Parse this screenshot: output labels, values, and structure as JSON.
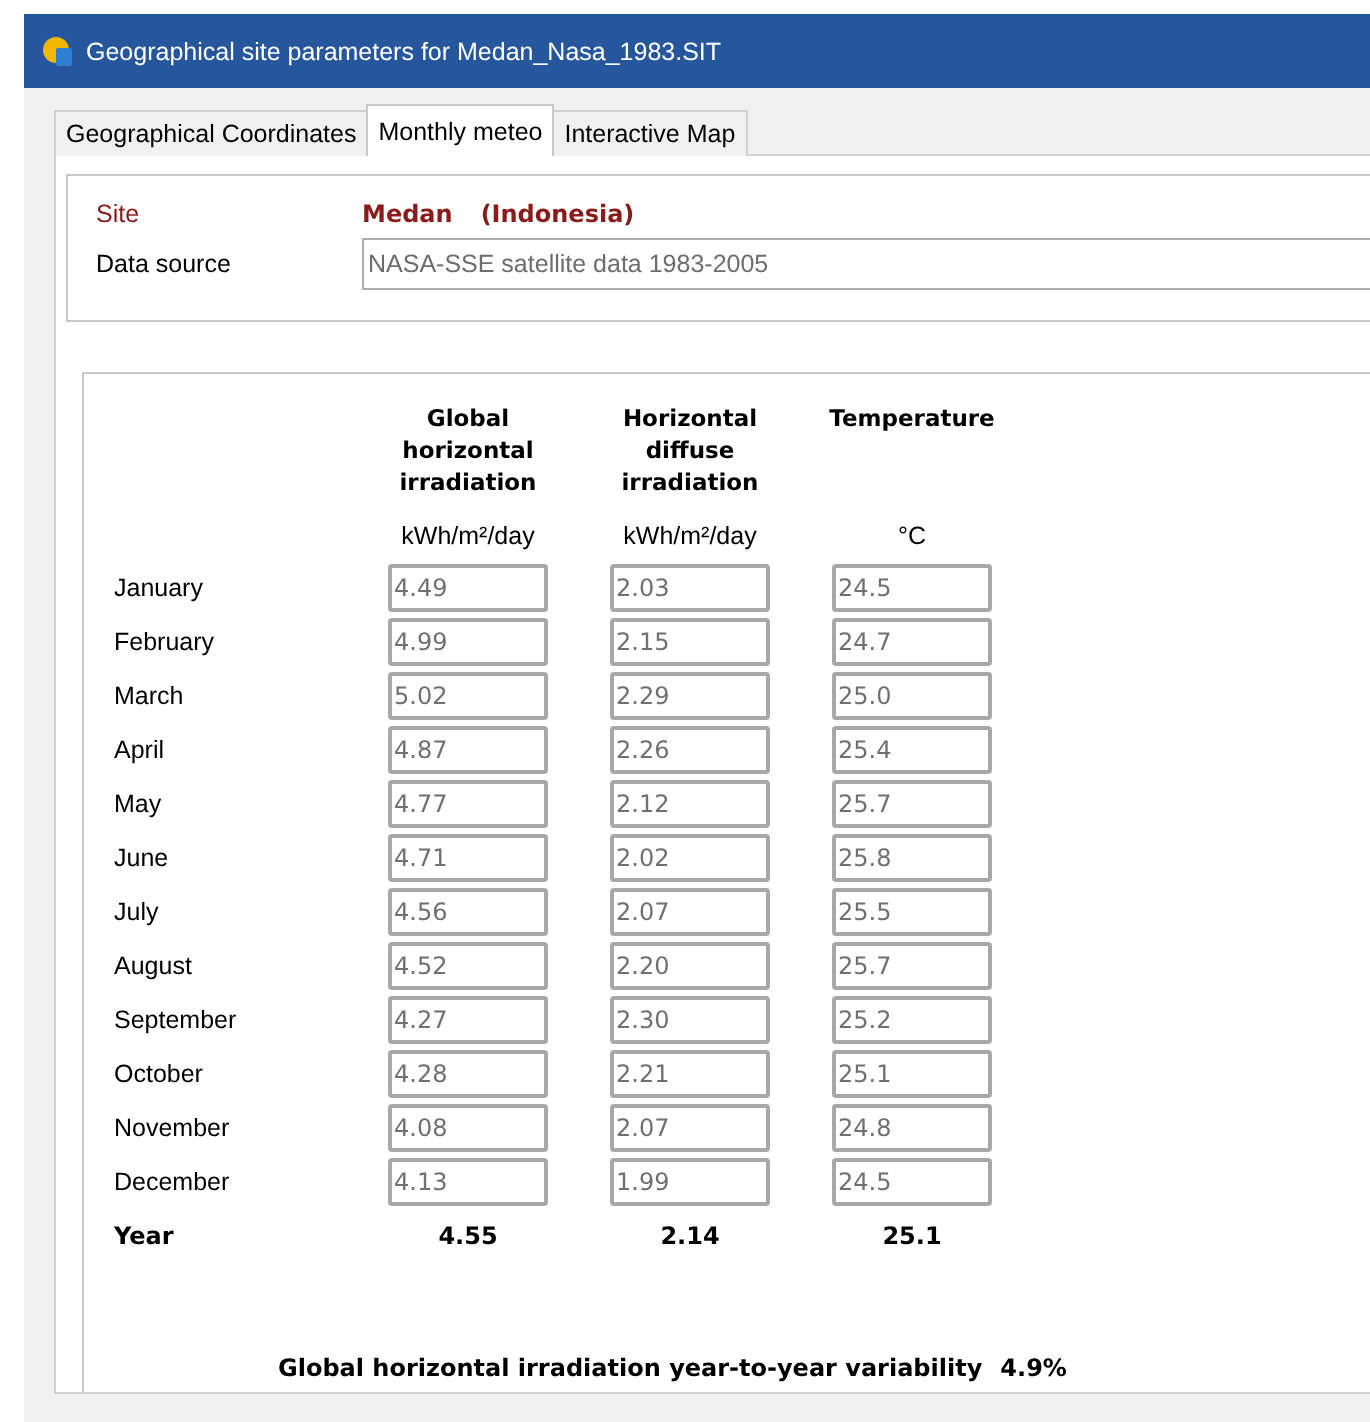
{
  "window": {
    "title": "Geographical site parameters for Medan_Nasa_1983.SIT"
  },
  "tabs": [
    {
      "label": "Geographical Coordinates",
      "selected": false
    },
    {
      "label": "Monthly meteo",
      "selected": true
    },
    {
      "label": "Interactive Map",
      "selected": false
    }
  ],
  "site": {
    "label": "Site",
    "name": "Medan",
    "country": "(Indonesia)"
  },
  "data_source": {
    "label": "Data source",
    "value": "NASA-SSE satellite data 1983-2005"
  },
  "table": {
    "columns": [
      {
        "heading": "Global horizontal irradiation",
        "unit": "kWh/m²/day"
      },
      {
        "heading": "Horizontal diffuse irradiation",
        "unit": "kWh/m²/day"
      },
      {
        "heading": "Temperature",
        "unit": "°C"
      }
    ],
    "rows": [
      {
        "month": "January",
        "values": [
          "4.49",
          "2.03",
          "24.5"
        ]
      },
      {
        "month": "February",
        "values": [
          "4.99",
          "2.15",
          "24.7"
        ]
      },
      {
        "month": "March",
        "values": [
          "5.02",
          "2.29",
          "25.0"
        ]
      },
      {
        "month": "April",
        "values": [
          "4.87",
          "2.26",
          "25.4"
        ]
      },
      {
        "month": "May",
        "values": [
          "4.77",
          "2.12",
          "25.7"
        ]
      },
      {
        "month": "June",
        "values": [
          "4.71",
          "2.02",
          "25.8"
        ]
      },
      {
        "month": "July",
        "values": [
          "4.56",
          "2.07",
          "25.5"
        ]
      },
      {
        "month": "August",
        "values": [
          "4.52",
          "2.20",
          "25.7"
        ]
      },
      {
        "month": "September",
        "values": [
          "4.27",
          "2.30",
          "25.2"
        ]
      },
      {
        "month": "October",
        "values": [
          "4.28",
          "2.21",
          "25.1"
        ]
      },
      {
        "month": "November",
        "values": [
          "4.08",
          "2.07",
          "24.8"
        ]
      },
      {
        "month": "December",
        "values": [
          "4.13",
          "1.99",
          "24.5"
        ]
      }
    ],
    "year": {
      "label": "Year",
      "values": [
        "4.55",
        "2.14",
        "25.1"
      ]
    }
  },
  "variability": {
    "label": "Global horizontal irradiation year-to-year variability",
    "value": "4.9%"
  }
}
